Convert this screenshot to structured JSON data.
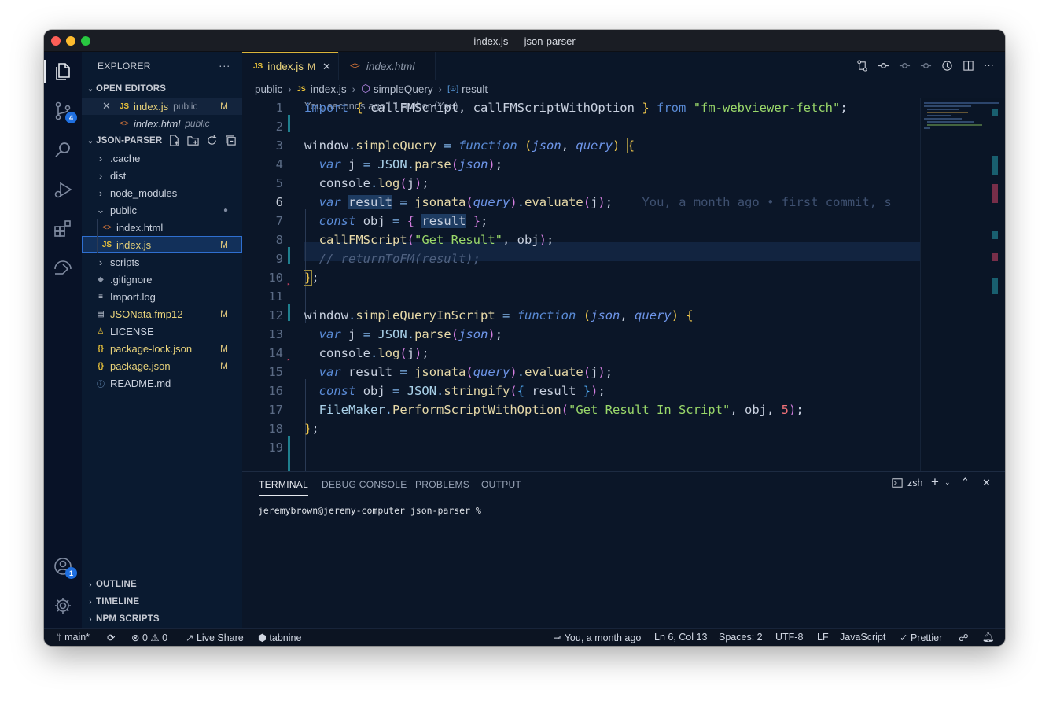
{
  "window": {
    "title": "index.js — json-parser"
  },
  "colors": {
    "accent": "#1f6fe0",
    "modified": "#d9c27a",
    "string": "#9ad86a",
    "keyword": "#5a8bd6"
  },
  "activity_bar": {
    "items": [
      {
        "name": "explorer-icon",
        "badge": ""
      },
      {
        "name": "source-control-icon",
        "badge": "4"
      },
      {
        "name": "search-icon",
        "badge": ""
      },
      {
        "name": "run-debug-icon",
        "badge": ""
      },
      {
        "name": "extensions-icon",
        "badge": ""
      },
      {
        "name": "remote-explorer-icon",
        "badge": ""
      }
    ],
    "accounts_badge": "1"
  },
  "sidebar": {
    "title": "EXPLORER",
    "more": "···",
    "open_editors_label": "OPEN EDITORS",
    "open_editors": [
      {
        "name": "index.js",
        "folder": "public",
        "status": "M",
        "icon": "JS"
      },
      {
        "name": "index.html",
        "folder": "public",
        "status": "",
        "icon": "<>"
      }
    ],
    "project_label": "JSON-PARSER",
    "tree": [
      {
        "label": ".cache",
        "type": "folder",
        "status": ""
      },
      {
        "label": "dist",
        "type": "folder",
        "status": ""
      },
      {
        "label": "node_modules",
        "type": "folder",
        "status": ""
      },
      {
        "label": "public",
        "type": "folder-open",
        "status": "●"
      },
      {
        "label": "index.html",
        "type": "html",
        "status": ""
      },
      {
        "label": "index.js",
        "type": "js",
        "status": "M"
      },
      {
        "label": "scripts",
        "type": "folder",
        "status": ""
      },
      {
        "label": ".gitignore",
        "type": "git",
        "status": ""
      },
      {
        "label": "Import.log",
        "type": "log",
        "status": ""
      },
      {
        "label": "JSONata.fmp12",
        "type": "file",
        "status": "M"
      },
      {
        "label": "LICENSE",
        "type": "license",
        "status": ""
      },
      {
        "label": "package-lock.json",
        "type": "json",
        "status": "M"
      },
      {
        "label": "package.json",
        "type": "json",
        "status": "M"
      },
      {
        "label": "README.md",
        "type": "info",
        "status": ""
      }
    ],
    "bottom_sections": [
      "OUTLINE",
      "TIMELINE",
      "NPM SCRIPTS"
    ]
  },
  "tabs": [
    {
      "icon": "JS",
      "label": "index.js",
      "status": "M",
      "active": true
    },
    {
      "icon": "<>",
      "label": "index.html",
      "status": "",
      "active": false
    }
  ],
  "breadcrumb": [
    "public",
    "index.js",
    "simpleQuery",
    "result"
  ],
  "codelens": "You, seconds ago | 1 author (You)",
  "editor": {
    "current_line": 6,
    "blame": "You, a month ago • first commit, s"
  },
  "code_lines": [
    {
      "n": 1
    },
    {
      "n": 2
    },
    {
      "n": 3
    },
    {
      "n": 4
    },
    {
      "n": 5
    },
    {
      "n": 6
    },
    {
      "n": 7
    },
    {
      "n": 8
    },
    {
      "n": 9
    },
    {
      "n": 10
    },
    {
      "n": 11
    },
    {
      "n": 12
    },
    {
      "n": 13
    },
    {
      "n": 14
    },
    {
      "n": 15
    },
    {
      "n": 16
    },
    {
      "n": 17
    },
    {
      "n": 18
    },
    {
      "n": 19
    }
  ],
  "code": {
    "l1_import": "import",
    "l1_names": "callFMScript, callFMScriptWithOption",
    "l1_from": "from",
    "l1_module": "\"fm-webviewer-fetch\"",
    "window": "window",
    "simpleQuery": "simpleQuery",
    "simpleQueryInScript": "simpleQueryInScript",
    "function": "function",
    "json": "json",
    "query": "query",
    "var": "var",
    "const": "const",
    "j": "j",
    "result": "result",
    "obj": "obj",
    "JSON": "JSON",
    "parse": "parse",
    "stringify": "stringify",
    "console": "console",
    "log": "log",
    "jsonata": "jsonata",
    "evaluate": "evaluate",
    "callFMScript": "callFMScript",
    "get_result": "\"Get Result\"",
    "comment": "// returnToFM(result);",
    "FileMaker": "FileMaker",
    "PerformScriptWithOption": "PerformScriptWithOption",
    "get_result_in_script": "\"Get Result In Script\"",
    "five": "5"
  },
  "panel": {
    "tabs": [
      "TERMINAL",
      "DEBUG CONSOLE",
      "PROBLEMS",
      "OUTPUT"
    ],
    "shell": "zsh",
    "prompt": "jeremybrown@jeremy-computer json-parser %"
  },
  "statusbar": {
    "branch": "main*",
    "errors": "0",
    "warnings": "0",
    "live_share": "Live Share",
    "tabnine": "tabnine",
    "blame": "You, a month ago",
    "position": "Ln 6, Col 13",
    "spaces": "Spaces: 2",
    "encoding": "UTF-8",
    "eol": "LF",
    "language": "JavaScript",
    "formatter": "Prettier"
  }
}
